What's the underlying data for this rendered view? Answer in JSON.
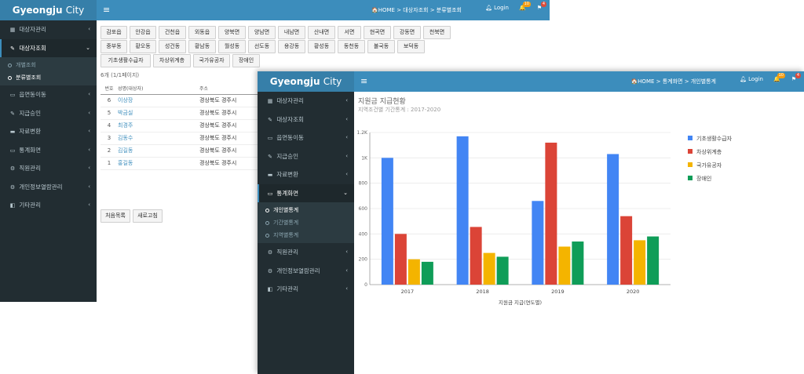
{
  "brand_bold": "Gyeongju",
  "brand_light": "City",
  "win1": {
    "breadcrumb": "🏠HOME > 대상자조회 > 분류별조회",
    "login": "Login",
    "bell_badge": "10",
    "flag_badge": "4",
    "menu": [
      {
        "label": "대상자관리",
        "icon": "▦",
        "active": false
      },
      {
        "label": "대상자조회",
        "icon": "✎",
        "active": true
      },
      {
        "label": "읍면동이동",
        "icon": "▭",
        "active": false
      },
      {
        "label": "지급승인",
        "icon": "✎",
        "active": false
      },
      {
        "label": "자료변환",
        "icon": "▬",
        "active": false
      },
      {
        "label": "통계화면",
        "icon": "▭",
        "active": false
      },
      {
        "label": "직원관리",
        "icon": "⚙",
        "active": false
      },
      {
        "label": "개인정보열람관리",
        "icon": "⚙",
        "active": false
      },
      {
        "label": "기타관리",
        "icon": "◧",
        "active": false
      }
    ],
    "submenu": [
      {
        "label": "개별조회",
        "on": false
      },
      {
        "label": "분류별조회",
        "on": true
      }
    ],
    "filters_row1": [
      "감포읍",
      "안강읍",
      "건천읍",
      "외동읍",
      "양북면",
      "양남면",
      "내남면",
      "산내면",
      "서면",
      "현곡면",
      "강동면",
      "천북면"
    ],
    "filters_row2": [
      "중부동",
      "황오동",
      "성건동",
      "황남동",
      "월성동",
      "선도동",
      "용강동",
      "황성동",
      "동천동",
      "불국동",
      "보덕동"
    ],
    "filters_row3": [
      "기초생활수급자",
      "차상위계층",
      "국가유공자",
      "장애인"
    ],
    "count_text": "6개 (1/1페이지)",
    "table_headers": [
      "번호",
      "성명(대상자)",
      "주소"
    ],
    "rows": [
      {
        "no": "6",
        "name": "이상장",
        "addr": "경상북도 경주시"
      },
      {
        "no": "5",
        "name": "박금실",
        "addr": "경상북도 경주시"
      },
      {
        "no": "4",
        "name": "최경주",
        "addr": "경상북도 경주시"
      },
      {
        "no": "3",
        "name": "김동수",
        "addr": "경상북도 경주시"
      },
      {
        "no": "2",
        "name": "김길동",
        "addr": "경상북도 경주시"
      },
      {
        "no": "1",
        "name": "홍길동",
        "addr": "경상북도 경주시"
      }
    ],
    "btn_first": "처음목록",
    "btn_refresh": "새로고침"
  },
  "win2": {
    "breadcrumb": "🏠HOME > 통계화면 > 개인별통계",
    "login": "Login",
    "bell_badge": "10",
    "flag_badge": "4",
    "menu": [
      {
        "label": "대상자관리",
        "icon": "▦",
        "active": false
      },
      {
        "label": "대상자조회",
        "icon": "✎",
        "active": false
      },
      {
        "label": "읍면동이동",
        "icon": "▭",
        "active": false
      },
      {
        "label": "지급승인",
        "icon": "✎",
        "active": false
      },
      {
        "label": "자료변환",
        "icon": "▬",
        "active": false
      },
      {
        "label": "통계화면",
        "icon": "▭",
        "active": true
      }
    ],
    "submenu": [
      {
        "label": "개인별통계",
        "on": true
      },
      {
        "label": "기간별통계",
        "on": false
      },
      {
        "label": "지역별통계",
        "on": false
      }
    ],
    "menu_after": [
      {
        "label": "직원관리",
        "icon": "⚙"
      },
      {
        "label": "개인정보열람관리",
        "icon": "⚙"
      },
      {
        "label": "기타관리",
        "icon": "◧"
      }
    ],
    "chart_title": "지원금 지급현황",
    "chart_subtitle": "지역조건별 기간통계 : 2017-2020"
  },
  "chart_data": {
    "type": "bar",
    "categories": [
      "2017",
      "2018",
      "2019",
      "2020"
    ],
    "series": [
      {
        "name": "기초생활수급자",
        "color": "#4285f4",
        "values": [
          1000,
          1170,
          660,
          1030
        ]
      },
      {
        "name": "차상위계층",
        "color": "#db4437",
        "values": [
          400,
          455,
          1120,
          540
        ]
      },
      {
        "name": "국가유공자",
        "color": "#f4b400",
        "values": [
          200,
          250,
          300,
          350
        ]
      },
      {
        "name": "장애인",
        "color": "#0f9d58",
        "values": [
          180,
          220,
          340,
          380
        ]
      }
    ],
    "yticks": [
      "0",
      "200",
      "400",
      "600",
      "800",
      "1K",
      "1.2K"
    ],
    "ylim": [
      0,
      1200
    ],
    "xlabel": "지원금 지급(연도별)",
    "legend_position": "right"
  }
}
